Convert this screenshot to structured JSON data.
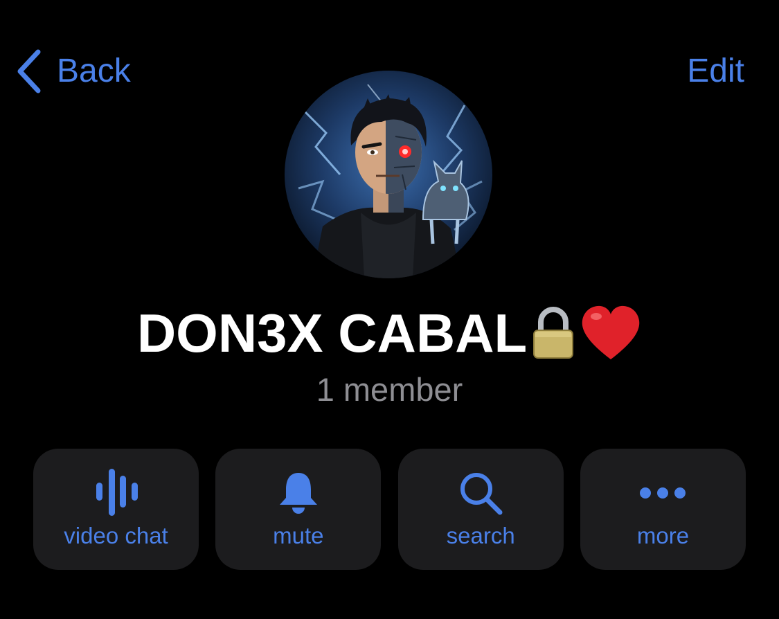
{
  "nav": {
    "back_label": "Back",
    "edit_label": "Edit",
    "back_icon": "chevron-left-icon"
  },
  "group": {
    "name": "DON3X CABAL",
    "name_emojis": [
      "lock-emoji",
      "red-heart-emoji"
    ],
    "member_count": "1 member",
    "avatar": "illustrated-avatar-man-half-cyborg-with-robot-cat"
  },
  "actions": [
    {
      "label": "video chat",
      "icon": "voice-waveform-icon"
    },
    {
      "label": "mute",
      "icon": "bell-icon"
    },
    {
      "label": "search",
      "icon": "magnifier-icon"
    },
    {
      "label": "more",
      "icon": "ellipsis-icon"
    }
  ],
  "colors": {
    "background": "#000000",
    "accent": "#4a80e8",
    "button_bg": "#1c1c1e",
    "title": "#ffffff",
    "subtitle": "#8e8e93"
  }
}
